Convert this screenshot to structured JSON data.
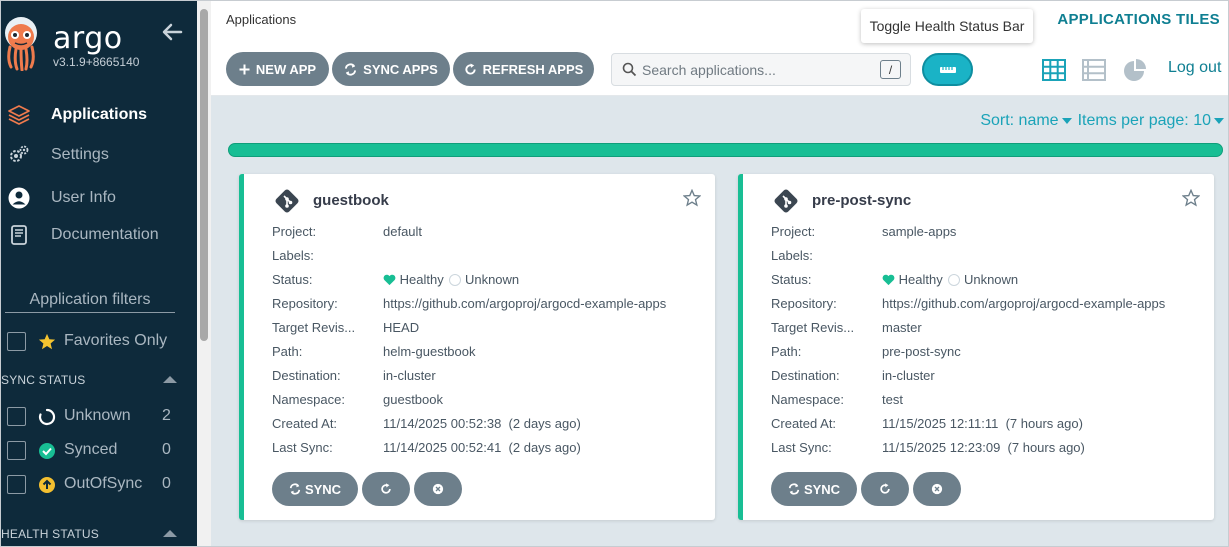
{
  "sidebar": {
    "brand": "argo",
    "version": "v3.1.9+8665140",
    "nav": [
      {
        "label": "Applications"
      },
      {
        "label": "Settings"
      },
      {
        "label": "User Info"
      },
      {
        "label": "Documentation"
      }
    ],
    "filters_title": "Application filters",
    "favorites_label": "Favorites Only",
    "sync_status": {
      "title": "SYNC STATUS",
      "items": [
        {
          "label": "Unknown",
          "count": "2"
        },
        {
          "label": "Synced",
          "count": "0"
        },
        {
          "label": "OutOfSync",
          "count": "0"
        }
      ]
    },
    "health_status_title": "HEALTH STATUS"
  },
  "header": {
    "breadcrumb": "Applications",
    "title": "APPLICATIONS TILES",
    "tooltip": "Toggle Health Status Bar",
    "new_app": "NEW APP",
    "sync_apps": "SYNC APPS",
    "refresh_apps": "REFRESH APPS",
    "search_placeholder": "Search applications...",
    "search_shortcut": "/",
    "logout": "Log out"
  },
  "sortbar": {
    "sort": "Sort: name",
    "items_per_page": "Items per page: 10"
  },
  "colors": {
    "sidebar_bg": "#0e2a3b",
    "accent": "#0f7f92",
    "healthy": "#18be94",
    "button": "#6d7f8b"
  },
  "field_labels": {
    "project": "Project:",
    "labels": "Labels:",
    "status": "Status:",
    "repository": "Repository:",
    "target_revision": "Target Revis...",
    "path": "Path:",
    "destination": "Destination:",
    "namespace": "Namespace:",
    "created_at": "Created At:",
    "last_sync": "Last Sync:"
  },
  "card_buttons": {
    "sync": "SYNC"
  },
  "apps": [
    {
      "name": "guestbook",
      "project": "default",
      "labels": "",
      "health": "Healthy",
      "sync": "Unknown",
      "repository": "https://github.com/argoproj/argocd-example-apps",
      "target_revision": "HEAD",
      "path": "helm-guestbook",
      "destination": "in-cluster",
      "namespace": "guestbook",
      "created_at": "11/14/2025 00:52:38  (2 days ago)",
      "last_sync": "11/14/2025 00:52:41  (2 days ago)"
    },
    {
      "name": "pre-post-sync",
      "project": "sample-apps",
      "labels": "",
      "health": "Healthy",
      "sync": "Unknown",
      "repository": "https://github.com/argoproj/argocd-example-apps",
      "target_revision": "master",
      "path": "pre-post-sync",
      "destination": "in-cluster",
      "namespace": "test",
      "created_at": "11/15/2025 12:11:11  (7 hours ago)",
      "last_sync": "11/15/2025 12:23:09  (7 hours ago)"
    }
  ]
}
